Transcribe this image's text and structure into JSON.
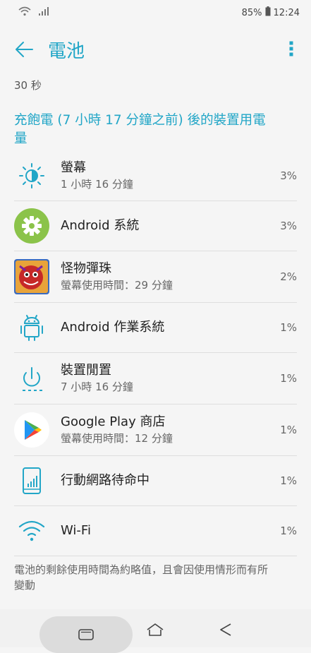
{
  "status_bar": {
    "battery": "85%",
    "time": "12:24",
    "wifi_icon": "wifi-icon",
    "signal_icon": "signal-icon"
  },
  "header": {
    "title": "電池",
    "back_icon": "arrow-left-icon",
    "more_icon": "more-vert-icon"
  },
  "duration": "30 秒",
  "section_title": "充飽電 (7 小時 17 分鐘之前) 後的裝置用電量",
  "items": [
    {
      "name": "螢幕",
      "sub": "1 小時 16 分鐘",
      "percent": "3%",
      "icon": "brightness-icon"
    },
    {
      "name": "Android 系統",
      "sub": "",
      "percent": "3%",
      "icon": "android-settings-gear-icon"
    },
    {
      "name": "怪物彈珠",
      "sub": "螢幕使用時間：29 分鐘",
      "percent": "2%",
      "icon": "game-app-icon"
    },
    {
      "name": "Android 作業系統",
      "sub": "",
      "percent": "1%",
      "icon": "android-robot-icon"
    },
    {
      "name": "裝置閒置",
      "sub": "7 小時 16 分鐘",
      "percent": "1%",
      "icon": "power-idle-icon"
    },
    {
      "name": "Google Play 商店",
      "sub": "螢幕使用時間：12 分鐘",
      "percent": "1%",
      "icon": "google-play-icon"
    },
    {
      "name": "行動網路待命中",
      "sub": "",
      "percent": "1%",
      "icon": "phone-signal-icon"
    },
    {
      "name": "Wi-Fi",
      "sub": "",
      "percent": "1%",
      "icon": "wifi-icon"
    }
  ],
  "footnote": "電池的剩餘使用時間為約略值，且會因使用情形而有所變動",
  "nav": {
    "recent_icon": "recent-apps-icon",
    "home_icon": "home-icon",
    "back_icon": "back-triangle-icon"
  },
  "colors": {
    "accent": "#22a6c7",
    "android_green": "#8bc34a"
  }
}
